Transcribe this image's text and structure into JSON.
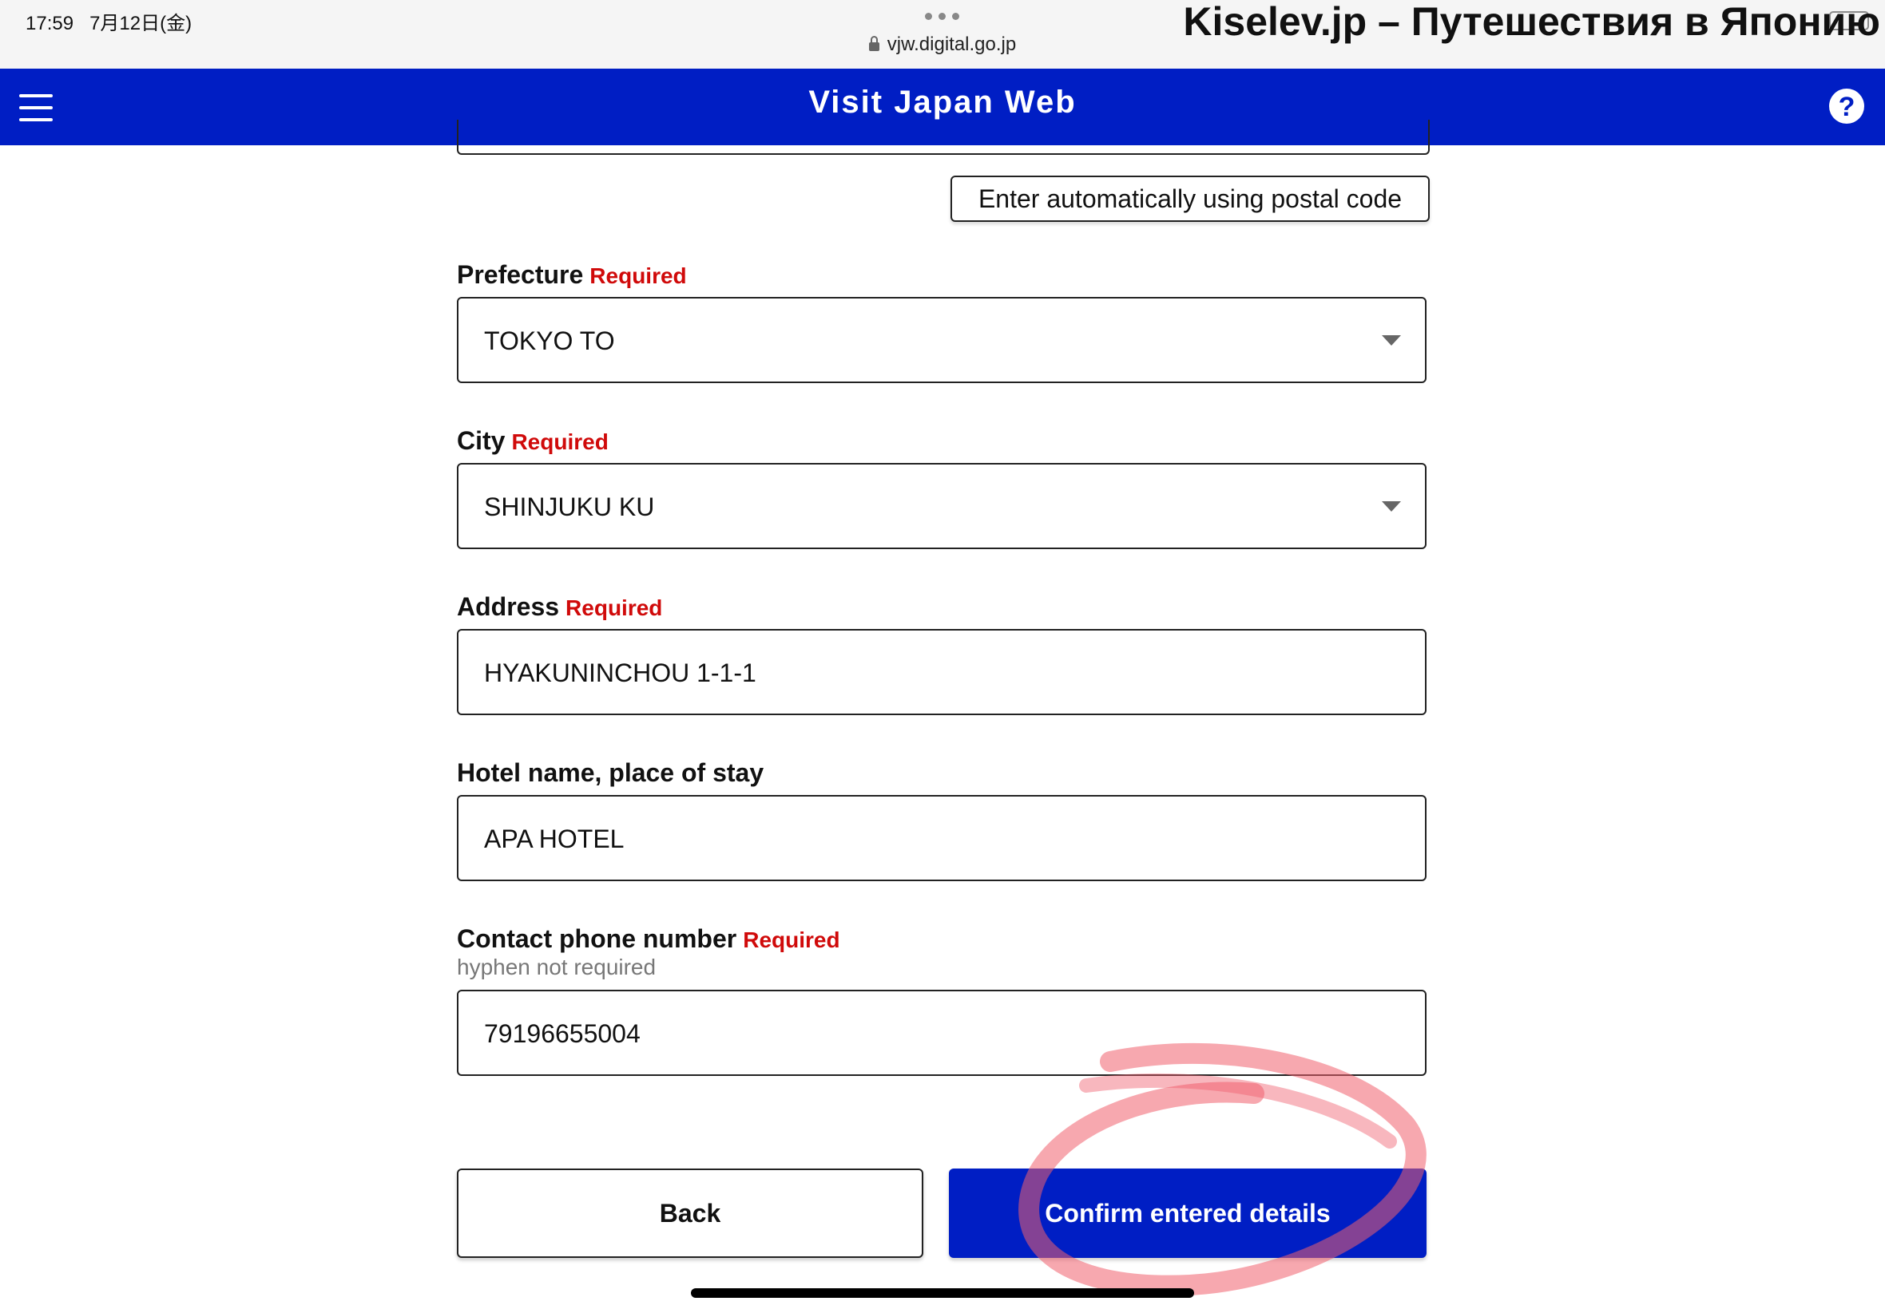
{
  "status_bar": {
    "time": "17:59",
    "date": "7月12日(金)",
    "url": "vjw.digital.go.jp",
    "watermark": "Kiselev.jp – Путешествия в Японию"
  },
  "header": {
    "title": "Visit Japan Web",
    "help": "?"
  },
  "form": {
    "postal_button": "Enter automatically using postal code",
    "required_text": "Required",
    "prefecture": {
      "label": "Prefecture",
      "value": "TOKYO TO"
    },
    "city": {
      "label": "City",
      "value": "SHINJUKU KU"
    },
    "address": {
      "label": "Address",
      "value": "HYAKUNINCHOU 1-1-1"
    },
    "hotel": {
      "label": "Hotel name, place of stay",
      "value": "APA HOTEL"
    },
    "phone": {
      "label": "Contact phone number",
      "hint": "hyphen not required",
      "value": "79196655004"
    }
  },
  "actions": {
    "back": "Back",
    "confirm": "Confirm entered details"
  },
  "colors": {
    "brand_blue": "#001ec4",
    "required_red": "#d00a0a",
    "annotation_red": "#f0606e"
  }
}
